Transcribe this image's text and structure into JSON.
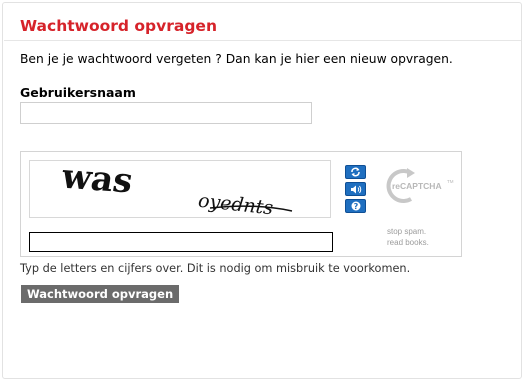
{
  "page": {
    "title": "Wachtwoord opvragen",
    "intro": "Ben je je wachtwoord vergeten ? Dan kan je hier een nieuw opvragen."
  },
  "form": {
    "username_label": "Gebruikersnaam",
    "username_value": "",
    "hint": "Typ de letters en cijfers over. Dit is nodig om misbruik te voorkomen.",
    "submit_label": "Wachtwoord opvragen"
  },
  "captcha": {
    "word1": "was",
    "word2": "oyednts",
    "response_value": "",
    "reload_icon": "reload-icon",
    "audio_icon": "audio-icon",
    "help_icon": "help-icon",
    "logo_text": "reCAPTCHA",
    "logo_tm": "TM",
    "tagline_line1": "stop spam.",
    "tagline_line2": "read books.",
    "button_color": "#1f6fc0"
  },
  "colors": {
    "title": "#d6232a",
    "submit_bg": "#6b6b6b"
  }
}
